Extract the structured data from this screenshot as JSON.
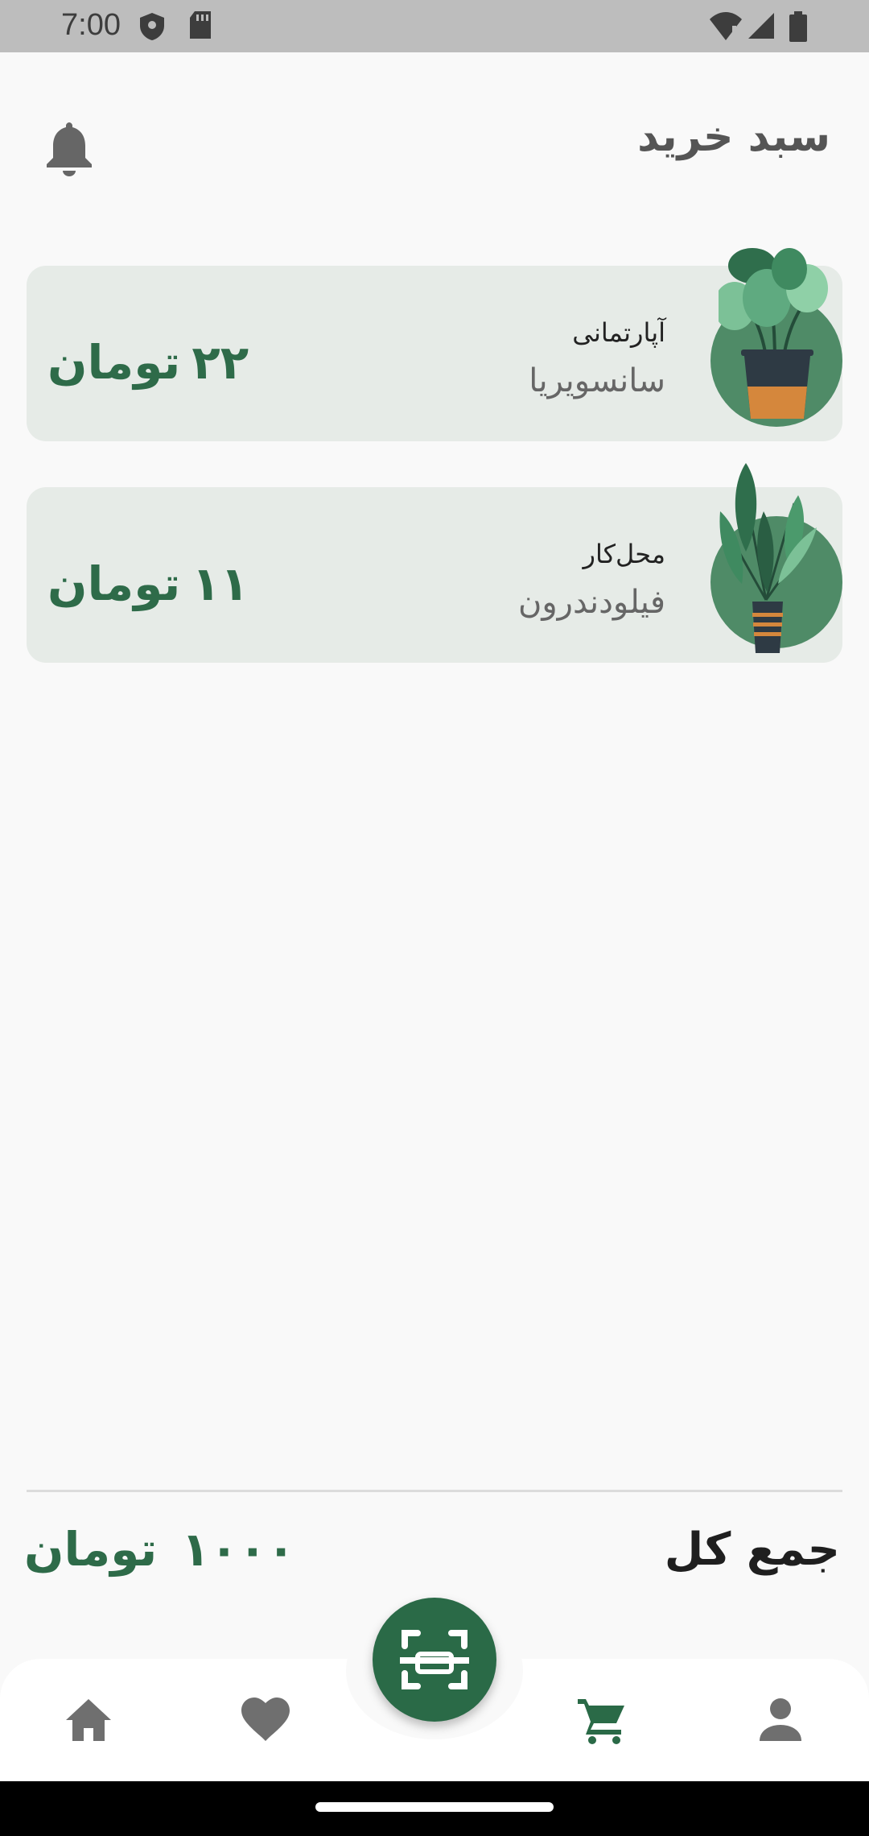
{
  "status_bar": {
    "time": "7:00"
  },
  "header": {
    "title": "سبد خرید"
  },
  "cart": {
    "items": [
      {
        "subtitle": "آپارتمانی",
        "name": "سانسویریا",
        "price": "۲۲",
        "currency": "تومان"
      },
      {
        "subtitle": "محل‌کار",
        "name": "فیلودندرون",
        "price": "۱۱",
        "currency": "تومان"
      }
    ]
  },
  "summary": {
    "total_label": "جمع کل",
    "total_value": "۱۰۰۰",
    "currency": "تومان"
  },
  "colors": {
    "accent": "#2a6a47",
    "card_bg": "#e6ebe7",
    "nav_active": "#2a6a47",
    "nav_inactive": "#6f6f6f"
  },
  "nav": {
    "items": [
      {
        "icon": "home-icon",
        "active": false
      },
      {
        "icon": "heart-icon",
        "active": false
      },
      {
        "icon": "scan-icon",
        "active": false
      },
      {
        "icon": "cart-icon",
        "active": true
      },
      {
        "icon": "person-icon",
        "active": false
      }
    ]
  }
}
